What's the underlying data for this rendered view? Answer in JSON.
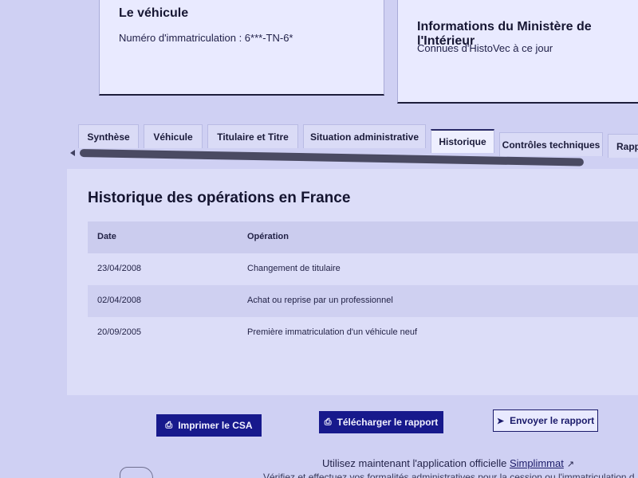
{
  "vehicle_card": {
    "title": "Le véhicule",
    "plate_text": "Numéro d'immatriculation : 6***-TN-6*"
  },
  "ministry_card": {
    "title": "Informations du Ministère de l'Intérieur",
    "subtitle": "Connues d'HistoVec à ce jour"
  },
  "tabs": [
    {
      "label": "Synthèse"
    },
    {
      "label": "Véhicule"
    },
    {
      "label": "Titulaire et Titre"
    },
    {
      "label": "Situation administrative"
    },
    {
      "label": "Historique",
      "active": true
    },
    {
      "label": "Contrôles techniques"
    },
    {
      "label": "Rapp"
    }
  ],
  "history": {
    "title": "Historique des opérations en France",
    "columns": [
      "Date",
      "Opération"
    ],
    "rows": [
      {
        "date": "23/04/2008",
        "operation": "Changement de titulaire"
      },
      {
        "date": "02/04/2008",
        "operation": "Achat ou reprise par un professionnel"
      },
      {
        "date": "20/09/2005",
        "operation": "Première immatriculation d'un véhicule neuf"
      }
    ]
  },
  "actions": {
    "print_label": "Imprimer le CSA",
    "download_label": "Télécharger le rapport",
    "send_label": "Envoyer le rapport"
  },
  "footer": {
    "prefix": "Utilisez maintenant l'application officielle",
    "link": "Simplimmat",
    "cut_line": "Vérifiez et effectuez vos formalités administratives pour la cession ou l'immatriculation d"
  },
  "icons": {
    "print": "printer-icon",
    "download": "printer-icon",
    "send": "send-arrow-icon",
    "external": "external-link-icon"
  },
  "colors": {
    "background": "#cfd0f3",
    "primary_button": "#17198c"
  }
}
